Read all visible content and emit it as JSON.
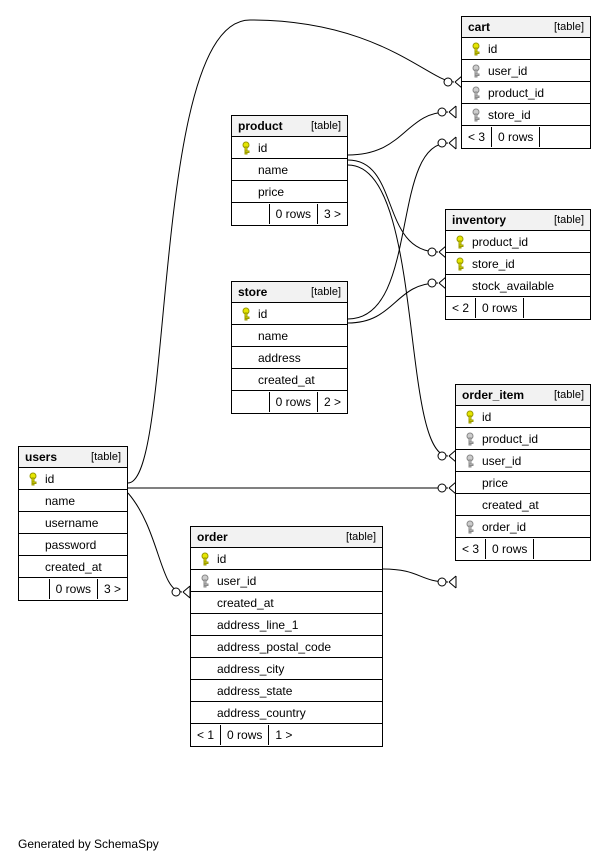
{
  "credit": "Generated by SchemaSpy",
  "chart_data": {
    "type": "table",
    "description": "Database schema / entity-relationship diagram",
    "tables": {
      "users": {
        "columns": [
          "id",
          "name",
          "username",
          "password",
          "created_at"
        ],
        "rows": 0,
        "refs_in": 0,
        "refs_out": 3
      },
      "product": {
        "columns": [
          "id",
          "name",
          "price"
        ],
        "rows": 0,
        "refs_in": 0,
        "refs_out": 3
      },
      "store": {
        "columns": [
          "id",
          "name",
          "address",
          "created_at"
        ],
        "rows": 0,
        "refs_in": 0,
        "refs_out": 2
      },
      "order": {
        "columns": [
          "id",
          "user_id",
          "created_at",
          "address_line_1",
          "address_postal_code",
          "address_city",
          "address_state",
          "address_country"
        ],
        "rows": 0,
        "refs_in": 1,
        "refs_out": 1
      },
      "cart": {
        "columns": [
          "id",
          "user_id",
          "product_id",
          "store_id"
        ],
        "rows": 0,
        "refs_in": 3,
        "refs_out": 0
      },
      "inventory": {
        "columns": [
          "product_id",
          "store_id",
          "stock_available"
        ],
        "rows": 0,
        "refs_in": 2,
        "refs_out": 0
      },
      "order_item": {
        "columns": [
          "id",
          "product_id",
          "user_id",
          "price",
          "created_at",
          "order_id"
        ],
        "rows": 0,
        "refs_in": 3,
        "refs_out": 0
      }
    },
    "relationships": [
      {
        "from": "users.id",
        "to": "cart.user_id"
      },
      {
        "from": "users.id",
        "to": "order.user_id"
      },
      {
        "from": "users.id",
        "to": "order_item.user_id"
      },
      {
        "from": "product.id",
        "to": "cart.product_id"
      },
      {
        "from": "product.id",
        "to": "inventory.product_id"
      },
      {
        "from": "product.id",
        "to": "order_item.product_id"
      },
      {
        "from": "store.id",
        "to": "cart.store_id"
      },
      {
        "from": "store.id",
        "to": "inventory.store_id"
      },
      {
        "from": "order.id",
        "to": "order_item.order_id"
      }
    ]
  },
  "tables": {
    "users": {
      "name": "users",
      "type": "[table]",
      "columns": [
        {
          "key": "pk",
          "label": "id"
        },
        {
          "key": "",
          "label": "name"
        },
        {
          "key": "",
          "label": "username"
        },
        {
          "key": "",
          "label": "password"
        },
        {
          "key": "",
          "label": "created_at"
        }
      ],
      "footer": [
        "",
        "0 rows",
        "3 >"
      ]
    },
    "product": {
      "name": "product",
      "type": "[table]",
      "columns": [
        {
          "key": "pk",
          "label": "id"
        },
        {
          "key": "",
          "label": "name"
        },
        {
          "key": "",
          "label": "price"
        }
      ],
      "footer": [
        "",
        "0 rows",
        "3 >"
      ]
    },
    "store": {
      "name": "store",
      "type": "[table]",
      "columns": [
        {
          "key": "pk",
          "label": "id"
        },
        {
          "key": "",
          "label": "name"
        },
        {
          "key": "",
          "label": "address"
        },
        {
          "key": "",
          "label": "created_at"
        }
      ],
      "footer": [
        "",
        "0 rows",
        "2 >"
      ]
    },
    "order": {
      "name": "order",
      "type": "[table]",
      "columns": [
        {
          "key": "pk",
          "label": "id"
        },
        {
          "key": "fk",
          "label": "user_id"
        },
        {
          "key": "",
          "label": "created_at"
        },
        {
          "key": "",
          "label": "address_line_1"
        },
        {
          "key": "",
          "label": "address_postal_code"
        },
        {
          "key": "",
          "label": "address_city"
        },
        {
          "key": "",
          "label": "address_state"
        },
        {
          "key": "",
          "label": "address_country"
        }
      ],
      "footer": [
        "< 1",
        "0 rows",
        "1 >"
      ]
    },
    "cart": {
      "name": "cart",
      "type": "[table]",
      "columns": [
        {
          "key": "pk",
          "label": "id"
        },
        {
          "key": "fk",
          "label": "user_id"
        },
        {
          "key": "fk",
          "label": "product_id"
        },
        {
          "key": "fk",
          "label": "store_id"
        }
      ],
      "footer": [
        "< 3",
        "0 rows",
        ""
      ]
    },
    "inventory": {
      "name": "inventory",
      "type": "[table]",
      "columns": [
        {
          "key": "pk",
          "label": "product_id"
        },
        {
          "key": "pk",
          "label": "store_id"
        },
        {
          "key": "",
          "label": "stock_available"
        }
      ],
      "footer": [
        "< 2",
        "0 rows",
        ""
      ]
    },
    "order_item": {
      "name": "order_item",
      "type": "[table]",
      "columns": [
        {
          "key": "pk",
          "label": "id"
        },
        {
          "key": "fk",
          "label": "product_id"
        },
        {
          "key": "fk",
          "label": "user_id"
        },
        {
          "key": "",
          "label": "price"
        },
        {
          "key": "",
          "label": "created_at"
        },
        {
          "key": "fk",
          "label": "order_id"
        }
      ],
      "footer": [
        "< 3",
        "0 rows",
        ""
      ]
    }
  }
}
